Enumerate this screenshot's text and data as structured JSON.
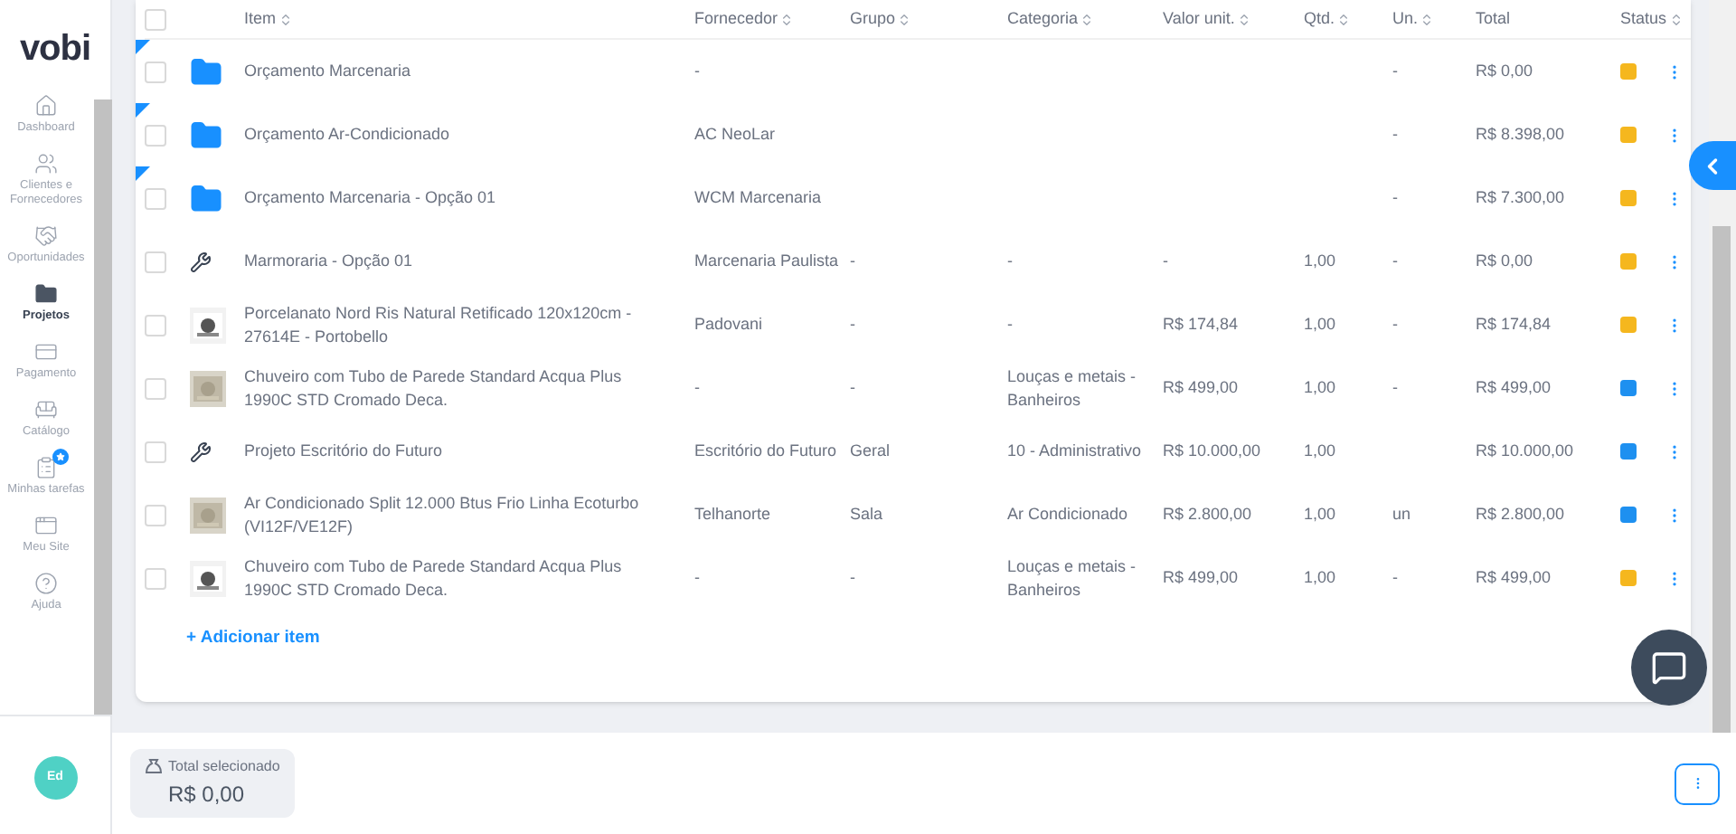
{
  "sidebar": {
    "logo": "vobi",
    "items": [
      {
        "label": "Dashboard",
        "selected": false
      },
      {
        "label": "Clientes e Fornecedores",
        "selected": false
      },
      {
        "label": "Oportunidades",
        "selected": false
      },
      {
        "label": "Projetos",
        "selected": true
      },
      {
        "label": "Pagamento",
        "selected": false
      },
      {
        "label": "Catálogo",
        "selected": false
      },
      {
        "label": "Minhas tarefas",
        "selected": false,
        "badge": true
      },
      {
        "label": "Meu Site",
        "selected": false
      },
      {
        "label": "Ajuda",
        "selected": false
      }
    ],
    "avatar": "Ed"
  },
  "table": {
    "select_all": {
      "checked": false
    },
    "columns": [
      {
        "label": "Item",
        "sortable": true
      },
      {
        "label": "Fornecedor",
        "sortable": true
      },
      {
        "label": "Grupo",
        "sortable": true
      },
      {
        "label": "Categoria",
        "sortable": true
      },
      {
        "label": "Valor unit.",
        "sortable": true
      },
      {
        "label": "Qtd.",
        "sortable": true
      },
      {
        "label": "Un.",
        "sortable": true
      },
      {
        "label": "Total",
        "sortable": false
      },
      {
        "label": "Status",
        "sortable": true
      }
    ],
    "rows": [
      {
        "kind": "folder",
        "checked": false,
        "item": "Orçamento Marcenaria",
        "fornecedor": "-",
        "grupo": "",
        "categoria": "",
        "valor": "",
        "qtd": "",
        "un": "-",
        "total": "R$ 0,00",
        "color": "#f5b71e"
      },
      {
        "kind": "folder",
        "checked": false,
        "item": "Orçamento Ar-Condicionado",
        "fornecedor": "AC NeoLar",
        "grupo": "",
        "categoria": "",
        "valor": "",
        "qtd": "",
        "un": "-",
        "total": "R$ 8.398,00",
        "color": "#f5b71e"
      },
      {
        "kind": "folder",
        "checked": false,
        "item": "Orçamento Marcenaria - Opção 01",
        "fornecedor": "WCM Marcenaria",
        "grupo": "",
        "categoria": "",
        "valor": "",
        "qtd": "",
        "un": "-",
        "total": "R$ 7.300,00",
        "color": "#f5b71e"
      },
      {
        "kind": "service",
        "checked": false,
        "item": "Marmoraria - Opção 01",
        "fornecedor": "Marcenaria Paulista",
        "grupo": "-",
        "categoria": "-",
        "valor": "-",
        "qtd": "1,00",
        "un": "-",
        "total": "R$ 0,00",
        "color": "#f5b71e"
      },
      {
        "kind": "product",
        "checked": false,
        "item": "Porcelanato Nord Ris Natural Retificado 120x120cm - 27614E - Portobello",
        "fornecedor": "Padovani",
        "grupo": "-",
        "categoria": "-",
        "valor": "R$ 174,84",
        "qtd": "1,00",
        "un": "-",
        "total": "R$ 174,84",
        "color": "#f5b71e"
      },
      {
        "kind": "product",
        "checked": false,
        "item": "Chuveiro com Tubo de Parede Standard Acqua Plus 1990C STD Cromado Deca.",
        "fornecedor": "-",
        "grupo": "-",
        "categoria": "Louças e metais - Banheiros",
        "valor": "R$ 499,00",
        "qtd": "1,00",
        "un": "-",
        "total": "R$ 499,00",
        "color": "#1e90f0"
      },
      {
        "kind": "service",
        "checked": false,
        "item": "Projeto Escritório do Futuro",
        "fornecedor": "Escritório do Futuro",
        "grupo": "Geral",
        "categoria": "10 - Administrativo",
        "valor": "R$ 10.000,00",
        "qtd": "1,00",
        "un": "",
        "total": "R$ 10.000,00",
        "color": "#1e90f0"
      },
      {
        "kind": "product",
        "checked": false,
        "item": "Ar Condicionado Split 12.000 Btus Frio Linha Ecoturbo (VI12F/VE12F)",
        "fornecedor": "Telhanorte",
        "grupo": "Sala",
        "categoria": "Ar Condicionado",
        "valor": "R$ 2.800,00",
        "qtd": "1,00",
        "un": "un",
        "total": "R$ 2.800,00",
        "color": "#1e90f0"
      },
      {
        "kind": "product",
        "checked": false,
        "item": "Chuveiro com Tubo de Parede Standard Acqua Plus 1990C STD Cromado Deca.",
        "fornecedor": "-",
        "grupo": "-",
        "categoria": "Louças e metais - Banheiros",
        "valor": "R$ 499,00",
        "qtd": "1,00",
        "un": "-",
        "total": "R$ 499,00",
        "color": "#f5b71e"
      }
    ],
    "add_item": "+ Adicionar item"
  },
  "footer": {
    "total_label": "Total selecionado",
    "total_value": "R$ 0,00"
  }
}
